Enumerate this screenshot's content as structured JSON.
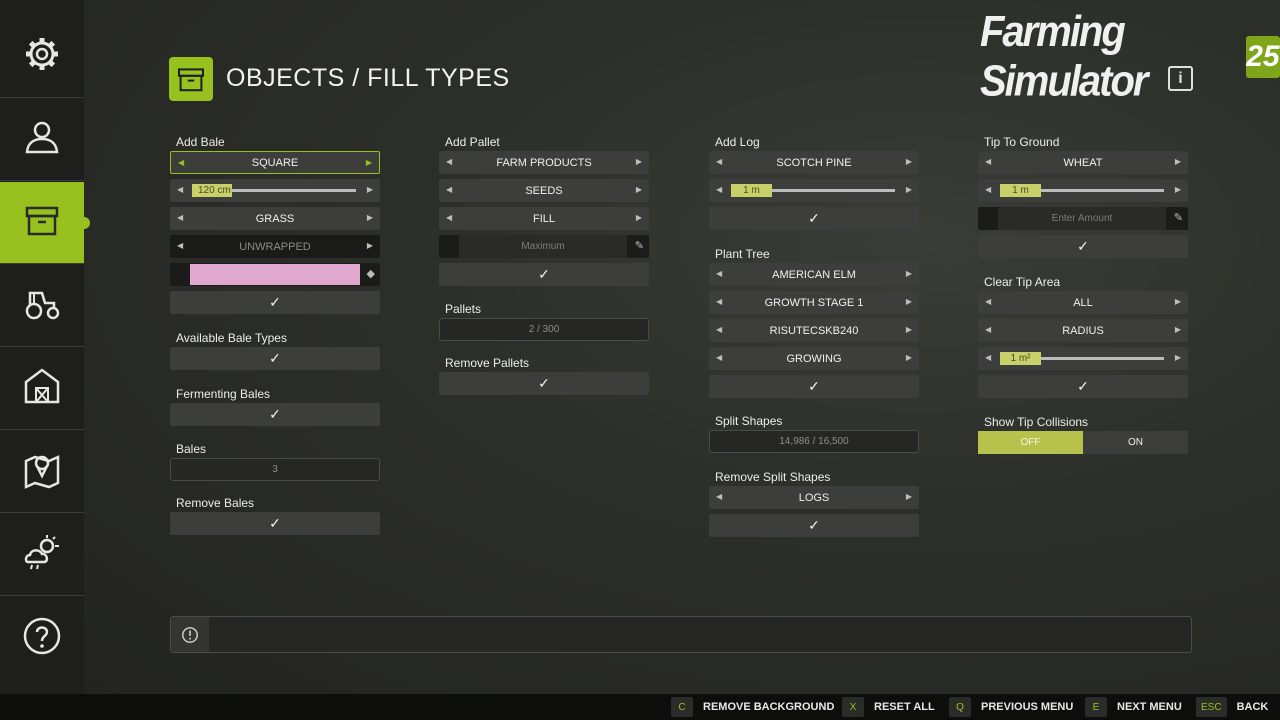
{
  "logo": {
    "text": "Farming Simulator",
    "badge": "25"
  },
  "info_label": "i",
  "page": {
    "title": "OBJECTS / FILL TYPES"
  },
  "colors": {
    "accent": "#96c11e",
    "bale_color": "#e0a8cf"
  },
  "sidebar": [
    {
      "name": "settings",
      "icon": "gear-icon"
    },
    {
      "name": "player",
      "icon": "person-icon"
    },
    {
      "name": "objects",
      "icon": "crate-icon",
      "active": true
    },
    {
      "name": "vehicles",
      "icon": "tractor-icon"
    },
    {
      "name": "farm",
      "icon": "barn-icon"
    },
    {
      "name": "map",
      "icon": "map-pin-icon"
    },
    {
      "name": "weather",
      "icon": "weather-icon"
    },
    {
      "name": "help",
      "icon": "help-icon"
    }
  ],
  "bale": {
    "label": "Add Bale",
    "shape": "SQUARE",
    "size": "120 cm",
    "size_fraction": 0.2,
    "filltype": "GRASS",
    "wrap": "UNWRAPPED",
    "available_label": "Available Bale Types",
    "fermenting_label": "Fermenting Bales",
    "bales_label": "Bales",
    "bales_count": "3",
    "remove_label": "Remove Bales"
  },
  "pallet": {
    "label": "Add Pallet",
    "category": "FARM PRODUCTS",
    "type": "SEEDS",
    "mode": "FILL",
    "amount_placeholder": "Maximum",
    "pallets_label": "Pallets",
    "pallets_count": "2 / 300",
    "remove_label": "Remove Pallets"
  },
  "log": {
    "label": "Add Log",
    "tree": "SCOTCH PINE",
    "length": "1 m",
    "length_fraction": 0.25
  },
  "plant": {
    "label": "Plant Tree",
    "tree": "AMERICAN ELM",
    "stage": "GROWTH STAGE 1",
    "variant": "RISUTECSKB240",
    "state": "GROWING"
  },
  "split": {
    "label": "Split Shapes",
    "count": "14,986 / 16,500",
    "remove_label": "Remove Split Shapes",
    "remove_type": "LOGS"
  },
  "tip": {
    "label": "Tip To Ground",
    "filltype": "WHEAT",
    "amount": "1 m",
    "amount_fraction": 0.25,
    "placeholder": "Enter Amount"
  },
  "clear": {
    "label": "Clear Tip Area",
    "scope": "ALL",
    "mode": "RADIUS",
    "radius": "1 m²",
    "radius_fraction": 0.25
  },
  "collisions": {
    "label": "Show Tip Collisions",
    "off": "OFF",
    "on": "ON",
    "selected": "OFF"
  },
  "check": "✓",
  "footer": [
    {
      "key": "C",
      "label": "REMOVE BACKGROUND"
    },
    {
      "key": "X",
      "label": "RESET ALL"
    },
    {
      "key": "Q",
      "label": "PREVIOUS MENU"
    },
    {
      "key": "E",
      "label": "NEXT MENU"
    },
    {
      "key": "ESC",
      "label": "BACK"
    }
  ]
}
